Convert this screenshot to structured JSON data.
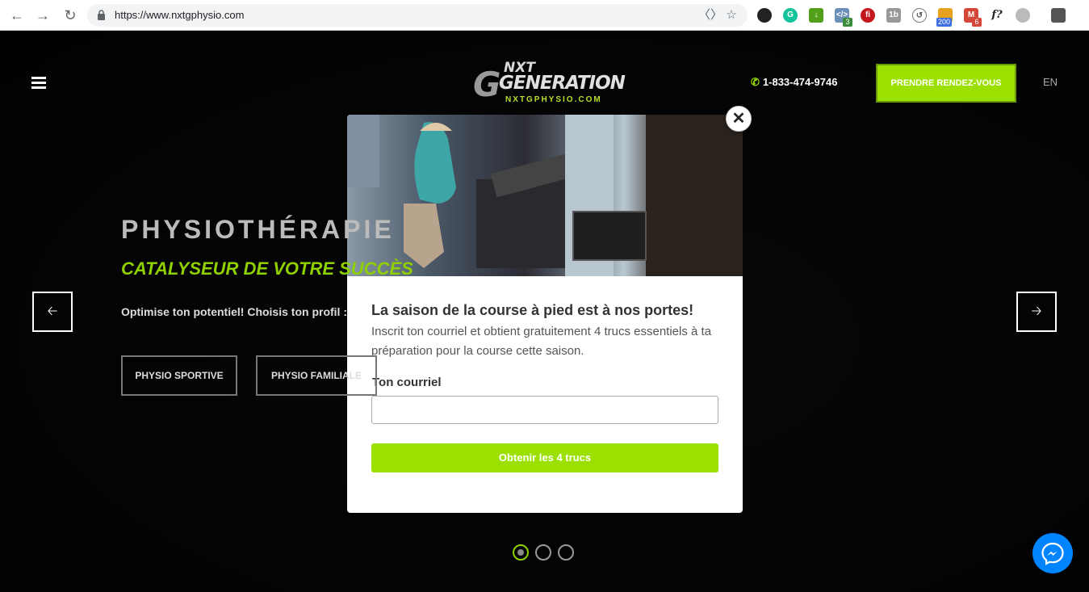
{
  "browser": {
    "url": "https://www.nxtgphysio.com",
    "extension_badges": [
      "3",
      "200",
      "6"
    ],
    "ext_label_fquestion": "f?",
    "ext_label_1b": "1b"
  },
  "site": {
    "logo": {
      "top_word": "NXT",
      "big_word": "GENERATION",
      "tagline": "NXTGPHYSIO.COM"
    },
    "phone": "1-833-474-9746",
    "cta_button": "PRENDRE RENDEZ-VOUS",
    "language": "EN",
    "hero": {
      "title": "PHYSIOTHÉRAPIE",
      "subtitle": "CATALYSEUR DE VOTRE SUCCÈS",
      "text": "Optimise ton potentiel! Choisis ton profil :",
      "buttons": [
        "PHYSIO SPORTIVE",
        "PHYSIO FAMILIALE"
      ]
    },
    "carousel": {
      "slide_count": 3,
      "active_index": 0
    }
  },
  "modal": {
    "title": "La saison de la course à pied est à nos portes!",
    "description": "Inscrit ton courriel et obtient gratuitement 4 trucs essentiels à ta préparation pour la course cette saison.",
    "email_label": "Ton courriel",
    "email_value": "",
    "email_placeholder": "",
    "submit_label": "Obtenir les 4 trucs",
    "close_symbol": "✕"
  }
}
